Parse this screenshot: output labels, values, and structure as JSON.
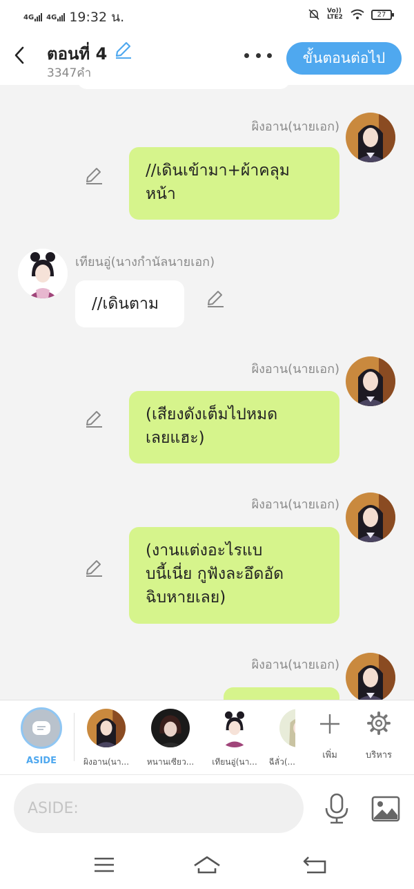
{
  "status": {
    "net1": "4G",
    "net2": "4G",
    "time": "19:32 น.",
    "volte": "Vo)) LTE2",
    "battery": "27"
  },
  "header": {
    "title": "ตอนที่ 4",
    "word_count": "3347คำ",
    "next_button": "ขั้นตอนต่อไป"
  },
  "messages": [
    {
      "speaker": "ผิงอาน(นายเอก)",
      "text": "//เดินเข้ามา+ผ้าคลุม\nหน้า",
      "side": "right"
    },
    {
      "speaker": "เทียนอู่(นางกำนัลนายเอก)",
      "text": "//เดินตาม",
      "side": "left"
    },
    {
      "speaker": "ผิงอาน(นายเอก)",
      "text": "(เสียงดังเต็มไปหมด\nเลยแฮะ)",
      "side": "right"
    },
    {
      "speaker": "ผิงอาน(นายเอก)",
      "text": "(งานแต่งอะไรแบ\nบนี้เนี่ย กูฟังละอึดอัด\nฉิบหายเลย)",
      "side": "right"
    },
    {
      "speaker": "ผิงอาน(นายเอก)",
      "text": "",
      "side": "right"
    }
  ],
  "characters": {
    "aside_label": "ASIDE",
    "items": [
      {
        "label": "ผิงอาน(นา..."
      },
      {
        "label": "หนานเซียว..."
      },
      {
        "label": "เทียนอู่(นา..."
      },
      {
        "label": "ฉีลั่ว(..."
      }
    ],
    "add_label": "เพิ่ม",
    "manage_label": "บริหาร"
  },
  "input": {
    "placeholder": "ASIDE:"
  },
  "colors": {
    "accent": "#4fa8ef",
    "bubble_green": "#d6f48c",
    "background": "#f3f3f3"
  }
}
